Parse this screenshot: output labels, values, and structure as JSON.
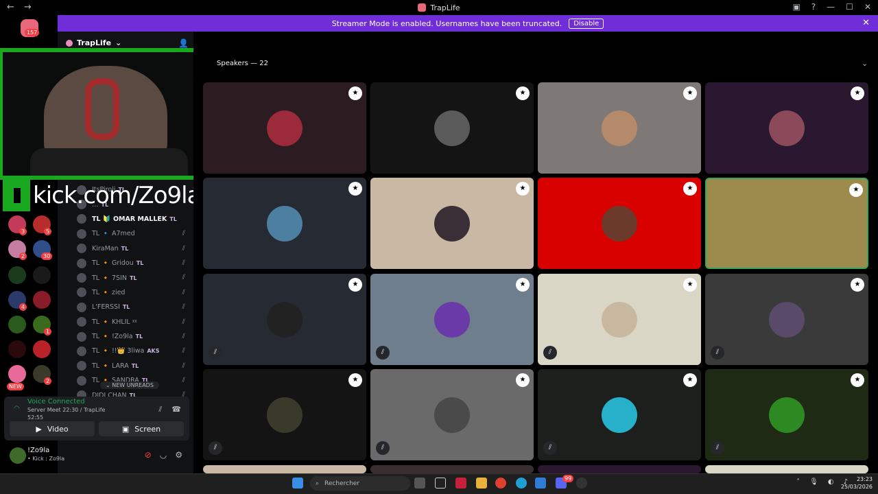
{
  "window": {
    "title": "TrapLife",
    "nav_back": "←",
    "nav_fwd": "→",
    "ctrl_inbox": "▣",
    "ctrl_help": "?",
    "ctrl_min": "—",
    "ctrl_max": "☐",
    "ctrl_close": "✕"
  },
  "banner": {
    "text": "Streamer Mode is enabled. Usernames have been truncated.",
    "button": "Disable",
    "close": "✕"
  },
  "rail": {
    "dm_badge": "157",
    "new_label": "NEW",
    "badges": [
      "3",
      "5",
      "2",
      "30",
      "4",
      "1",
      "2"
    ]
  },
  "server": {
    "name": "TrapLife",
    "chevron": "⌄",
    "invite_icon": "👤"
  },
  "overlay": {
    "kick_text": "kick.com/Zo9la"
  },
  "members": [
    {
      "name": "ItsPiroli",
      "tag": "TL"
    },
    {
      "name": "…",
      "tag": "TL"
    },
    {
      "name": "TL 🔰 OMAR MALLEK",
      "tag": "TL",
      "highlight": true
    },
    {
      "name": "TL 🔹 A7med",
      "tag": ""
    },
    {
      "name": "KiraMan",
      "tag": "TL"
    },
    {
      "name": "TL 🔸 Gridou",
      "tag": "TL"
    },
    {
      "name": "TL 🔸 7SIN",
      "tag": "TL"
    },
    {
      "name": "TL 🔸 zied",
      "tag": ""
    },
    {
      "name": "L'FERSSI",
      "tag": "TL"
    },
    {
      "name": "TL 🔸 KHLIL ᵡᵡ",
      "tag": ""
    },
    {
      "name": "TL 🔸 !Zo9la",
      "tag": "TL"
    },
    {
      "name": "TL 🔸 !!👑 3liwa",
      "tag": "AKS"
    },
    {
      "name": "TL 🔸 LARA",
      "tag": "TL"
    },
    {
      "name": "TL 🔸 SANDRA",
      "tag": "TL"
    },
    {
      "name": "DIDI CHAN",
      "tag": "TL"
    }
  ],
  "new_unreads": "⌄ NEW UNREADS",
  "voice": {
    "status": "Voice Connected",
    "channel": "Server Meet 22:30 / TrapLife",
    "elapsed": "52:55",
    "video_label": "Video",
    "screen_label": "Screen"
  },
  "user": {
    "name": "!Zo9la",
    "status": "• Kick : Zo9la"
  },
  "stage": {
    "speakers_label": "Speakers — 22",
    "chevron": "⌄"
  },
  "tiles": [
    {
      "bg": "#2b1c21",
      "avatar": "#9b2a3b",
      "muted": false
    },
    {
      "bg": "#141414",
      "avatar": "#5a5a5a",
      "muted": false
    },
    {
      "bg": "#7e7876",
      "avatar": "#b48a6a",
      "muted": false
    },
    {
      "bg": "#2a1830",
      "avatar": "#8a4a5a",
      "muted": false
    },
    {
      "bg": "#262b33",
      "avatar": "#4d7fa0",
      "muted": false
    },
    {
      "bg": "#c8b8a4",
      "avatar": "#3a2f36",
      "muted": false
    },
    {
      "bg": "#d90000",
      "avatar": "#6b3a2a",
      "muted": false
    },
    {
      "bg": "#9d8b4e",
      "avatar": "#9d8b4e",
      "muted": false,
      "selected": true
    },
    {
      "bg": "#262b33",
      "avatar": "#222222",
      "muted": true
    },
    {
      "bg": "#6e7e8c",
      "avatar": "#6a3aa8",
      "muted": true
    },
    {
      "bg": "#d9d6c6",
      "avatar": "#c8b8a0",
      "muted": true
    },
    {
      "bg": "#3a3a3a",
      "avatar": "#5a4a6a",
      "muted": true
    },
    {
      "bg": "#141414",
      "avatar": "#3a3a2a",
      "muted": true
    },
    {
      "bg": "#6a6a6a",
      "avatar": "#4a4a4a",
      "muted": true
    },
    {
      "bg": "#1c1f1c",
      "avatar": "#27b0c9",
      "muted": true
    },
    {
      "bg": "#1f2a14",
      "avatar": "#2d8a22",
      "muted": true
    }
  ],
  "taskbar": {
    "search_placeholder": "Rechercher",
    "time": "23:23",
    "date": "25/03/2026",
    "discord_badge": "99"
  }
}
